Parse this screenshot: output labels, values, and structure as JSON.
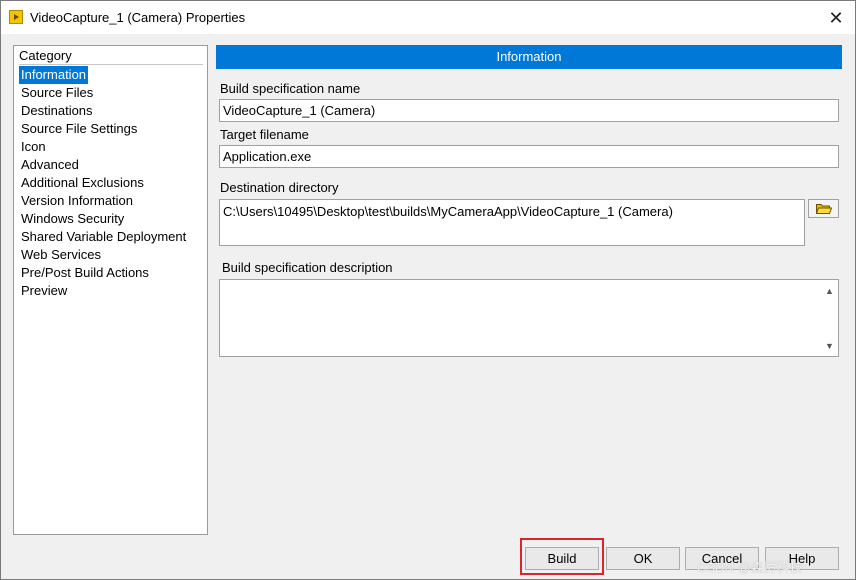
{
  "window": {
    "title": "VideoCapture_1 (Camera) Properties",
    "close_glyph": "✕"
  },
  "category": {
    "header": "Category",
    "items": [
      "Information",
      "Source Files",
      "Destinations",
      "Source File Settings",
      "Icon",
      "Advanced",
      "Additional Exclusions",
      "Version Information",
      "Windows Security",
      "Shared Variable Deployment",
      "Web Services",
      "Pre/Post Build Actions",
      "Preview"
    ],
    "selected_index": 0
  },
  "main": {
    "section_title": "Information",
    "build_spec_name_label": "Build specification name",
    "build_spec_name_value": "VideoCapture_1 (Camera)",
    "target_filename_label": "Target filename",
    "target_filename_value": "Application.exe",
    "destination_dir_label": "Destination directory",
    "destination_dir_value": "C:\\Users\\10495\\Desktop\\test\\builds\\MyCameraApp\\VideoCapture_1 (Camera)",
    "description_label": "Build specification description",
    "description_value": ""
  },
  "buttons": {
    "build": "Build",
    "ok": "OK",
    "cancel": "Cancel",
    "help": "Help"
  },
  "watermark": "CSDN @森厉科技",
  "colors": {
    "accent": "#0078d7",
    "highlight_box": "#d9262c"
  }
}
